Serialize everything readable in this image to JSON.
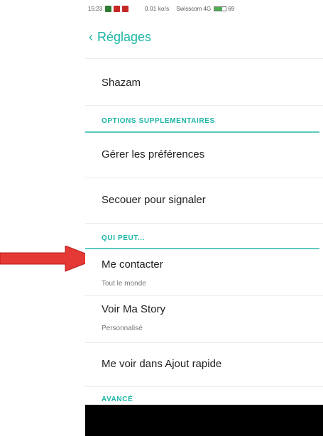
{
  "status_bar": {
    "time": "15:23",
    "info": "0.01 ko/s",
    "carrier": "Swisscom 4G",
    "battery_percent": "69",
    "battery_level": 0.69
  },
  "header": {
    "back_icon": "chevron-left-icon",
    "title": "Réglages"
  },
  "rows": {
    "shazam": "Shazam",
    "section_options": "OPTIONS SUPPLEMENTAIRES",
    "manage_prefs": "Gérer les préférences",
    "shake_report": "Secouer pour signaler",
    "section_who": "QUI PEUT...",
    "contact_me": "Me contacter",
    "contact_me_value": "Tout le monde",
    "view_story": "Voir Ma Story",
    "view_story_value": "Personnalisé",
    "quick_add": "Me voir dans Ajout rapide",
    "section_advanced": "AVANCÉ"
  },
  "colors": {
    "accent": "#1bb5a5",
    "arrow": "#e53935"
  }
}
